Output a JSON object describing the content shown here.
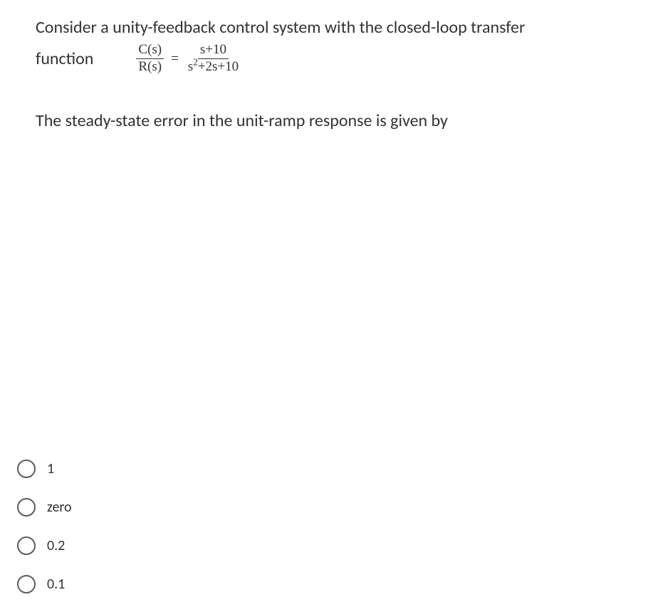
{
  "question": {
    "line1": "Consider a unity-feedback control system with the closed-loop transfer",
    "line2_word": "function",
    "eq_left_num": "C(s)",
    "eq_left_den": "R(s)",
    "eq_sign": "=",
    "eq_right_num": "s+10",
    "eq_right_den_a": "s",
    "eq_right_den_exp": "2",
    "eq_right_den_b": "+2s+10",
    "followup": "The steady-state error in the unit-ramp response is given by"
  },
  "options": [
    {
      "label": "1"
    },
    {
      "label": "zero"
    },
    {
      "label": "0.2"
    },
    {
      "label": "0.1"
    }
  ]
}
